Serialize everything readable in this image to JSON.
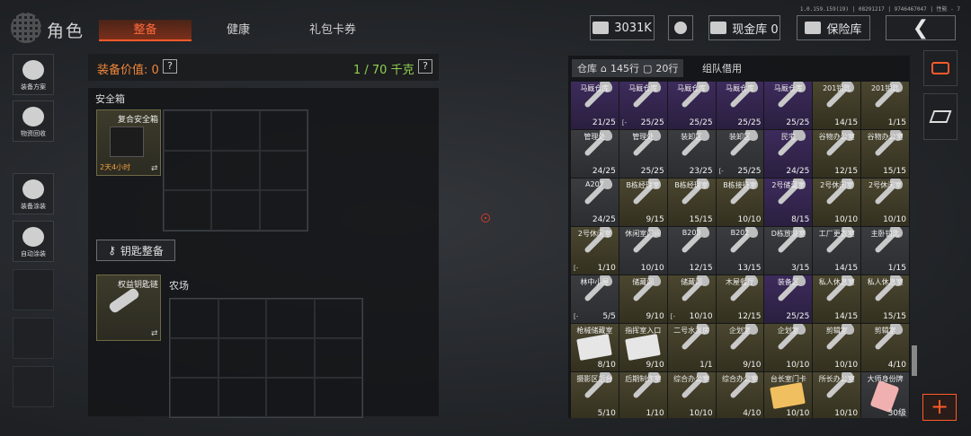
{
  "version": "1.0.159.159(19) | 08291217 | 9746467047 | 性能 - 7",
  "header": {
    "title": "角色",
    "tabs": [
      {
        "label": "整备",
        "active": true
      },
      {
        "label": "健康",
        "active": false
      },
      {
        "label": "礼包卡券",
        "active": false
      }
    ],
    "currency": "3031K",
    "cash_vault": "现金库 0",
    "insurance_vault": "保险库"
  },
  "sidebar": {
    "items": [
      {
        "label": "装备方案"
      },
      {
        "label": "物资回收"
      },
      {
        "label": "装备涂装"
      },
      {
        "label": "自动涂装"
      }
    ]
  },
  "loadout": {
    "value_label": "装备价值: 0",
    "help": "?",
    "weight": "1 / 70 千克",
    "safe_box": {
      "title": "安全箱",
      "item_name": "复合安全箱",
      "timer": "2天4小时"
    },
    "key_section": {
      "button_label": "钥匙整备",
      "item_name": "权益钥匙链",
      "area_title": "农场"
    }
  },
  "storage": {
    "tabs": {
      "warehouse": "仓库",
      "rows_1": "145行",
      "rows_2": "20行",
      "borrow": "组队借用"
    },
    "items": [
      [
        {
          "name": "马厩仓库",
          "count": "21/25",
          "color": "purple"
        },
        {
          "name": "马厩仓库",
          "count": "25/25",
          "color": "purple",
          "flag": "[-"
        },
        {
          "name": "马厩仓库",
          "count": "25/25",
          "color": "purple"
        },
        {
          "name": "马厩仓库",
          "count": "25/25",
          "color": "purple"
        },
        {
          "name": "马厩仓库",
          "count": "25/25",
          "color": "purple"
        },
        {
          "name": "201钥匙",
          "count": "14/15",
          "color": "gold"
        },
        {
          "name": "201钥匙",
          "count": "1/15",
          "color": "gold"
        }
      ],
      [
        {
          "name": "管理处",
          "count": "24/25",
          "color": "gray"
        },
        {
          "name": "管理处",
          "count": "25/25",
          "color": "gray"
        },
        {
          "name": "装卸区",
          "count": "23/25",
          "color": "gray"
        },
        {
          "name": "装卸区",
          "count": "25/25",
          "color": "gray",
          "flag": "[-"
        },
        {
          "name": "民宅",
          "count": "24/25",
          "color": "purple"
        },
        {
          "name": "谷物办公室",
          "count": "12/15",
          "color": "gold"
        },
        {
          "name": "谷物办公室",
          "count": "15/15",
          "color": "gold"
        }
      ],
      [
        {
          "name": "A207",
          "count": "24/25",
          "color": "gray"
        },
        {
          "name": "B栋经理室",
          "count": "9/15",
          "color": "gold"
        },
        {
          "name": "B栋经理室",
          "count": "15/15",
          "color": "gold"
        },
        {
          "name": "B栋接待室",
          "count": "10/10",
          "color": "gold"
        },
        {
          "name": "2号储藏室",
          "count": "8/15",
          "color": "purple"
        },
        {
          "name": "2号休闲室",
          "count": "10/10",
          "color": "gold"
        },
        {
          "name": "2号休闲室",
          "count": "10/10",
          "color": "gold"
        }
      ],
      [
        {
          "name": "2号休闲室",
          "count": "1/10",
          "color": "gold",
          "flag": "[-"
        },
        {
          "name": "休闲室门间",
          "count": "10/10",
          "color": "gray"
        },
        {
          "name": "B208",
          "count": "12/15",
          "color": "gray"
        },
        {
          "name": "B202",
          "count": "13/15",
          "color": "gray"
        },
        {
          "name": "D栋放映室",
          "count": "3/15",
          "color": "gray"
        },
        {
          "name": "工厂更衣室",
          "count": "14/15",
          "color": "gray"
        },
        {
          "name": "主卧钥匙",
          "count": "1/15",
          "color": "gray"
        }
      ],
      [
        {
          "name": "林中小屋",
          "count": "5/5",
          "color": "gray",
          "flag": "[-"
        },
        {
          "name": "储藏间",
          "count": "9/10",
          "color": "gold"
        },
        {
          "name": "储藏间",
          "count": "10/10",
          "color": "gold",
          "flag": "[-"
        },
        {
          "name": "木屋餐厅",
          "count": "12/15",
          "color": "gold"
        },
        {
          "name": "装备区",
          "count": "25/25",
          "color": "purple"
        },
        {
          "name": "私人休息室",
          "count": "14/15",
          "color": "gold"
        },
        {
          "name": "私人休息室",
          "count": "15/15",
          "color": "gold"
        }
      ],
      [
        {
          "name": "枪械储藏室",
          "count": "8/10",
          "color": "gold",
          "type": "card"
        },
        {
          "name": "指挥室入口",
          "count": "9/10",
          "color": "gold",
          "type": "card"
        },
        {
          "name": "二号水泵房",
          "count": "1/1",
          "color": "gold"
        },
        {
          "name": "企划室",
          "count": "9/10",
          "color": "gold"
        },
        {
          "name": "企划室",
          "count": "10/10",
          "color": "gold"
        },
        {
          "name": "剪辑室",
          "count": "10/10",
          "color": "gold"
        },
        {
          "name": "剪辑室",
          "count": "4/10",
          "color": "gold"
        }
      ],
      [
        {
          "name": "摄影区后台",
          "count": "5/10",
          "color": "gold"
        },
        {
          "name": "后期制作室",
          "count": "1/10",
          "color": "gold"
        },
        {
          "name": "综合办公室",
          "count": "10/10",
          "color": "gold"
        },
        {
          "name": "综合办公室",
          "count": "4/10",
          "color": "gold"
        },
        {
          "name": "台长室门卡",
          "count": "10/10",
          "color": "gold",
          "type": "card-yellow"
        },
        {
          "name": "所长办公室",
          "count": "10/10",
          "color": "gold"
        },
        {
          "name": "大师身份牌",
          "count": "30级",
          "color": "gray",
          "type": "tag"
        }
      ]
    ]
  }
}
